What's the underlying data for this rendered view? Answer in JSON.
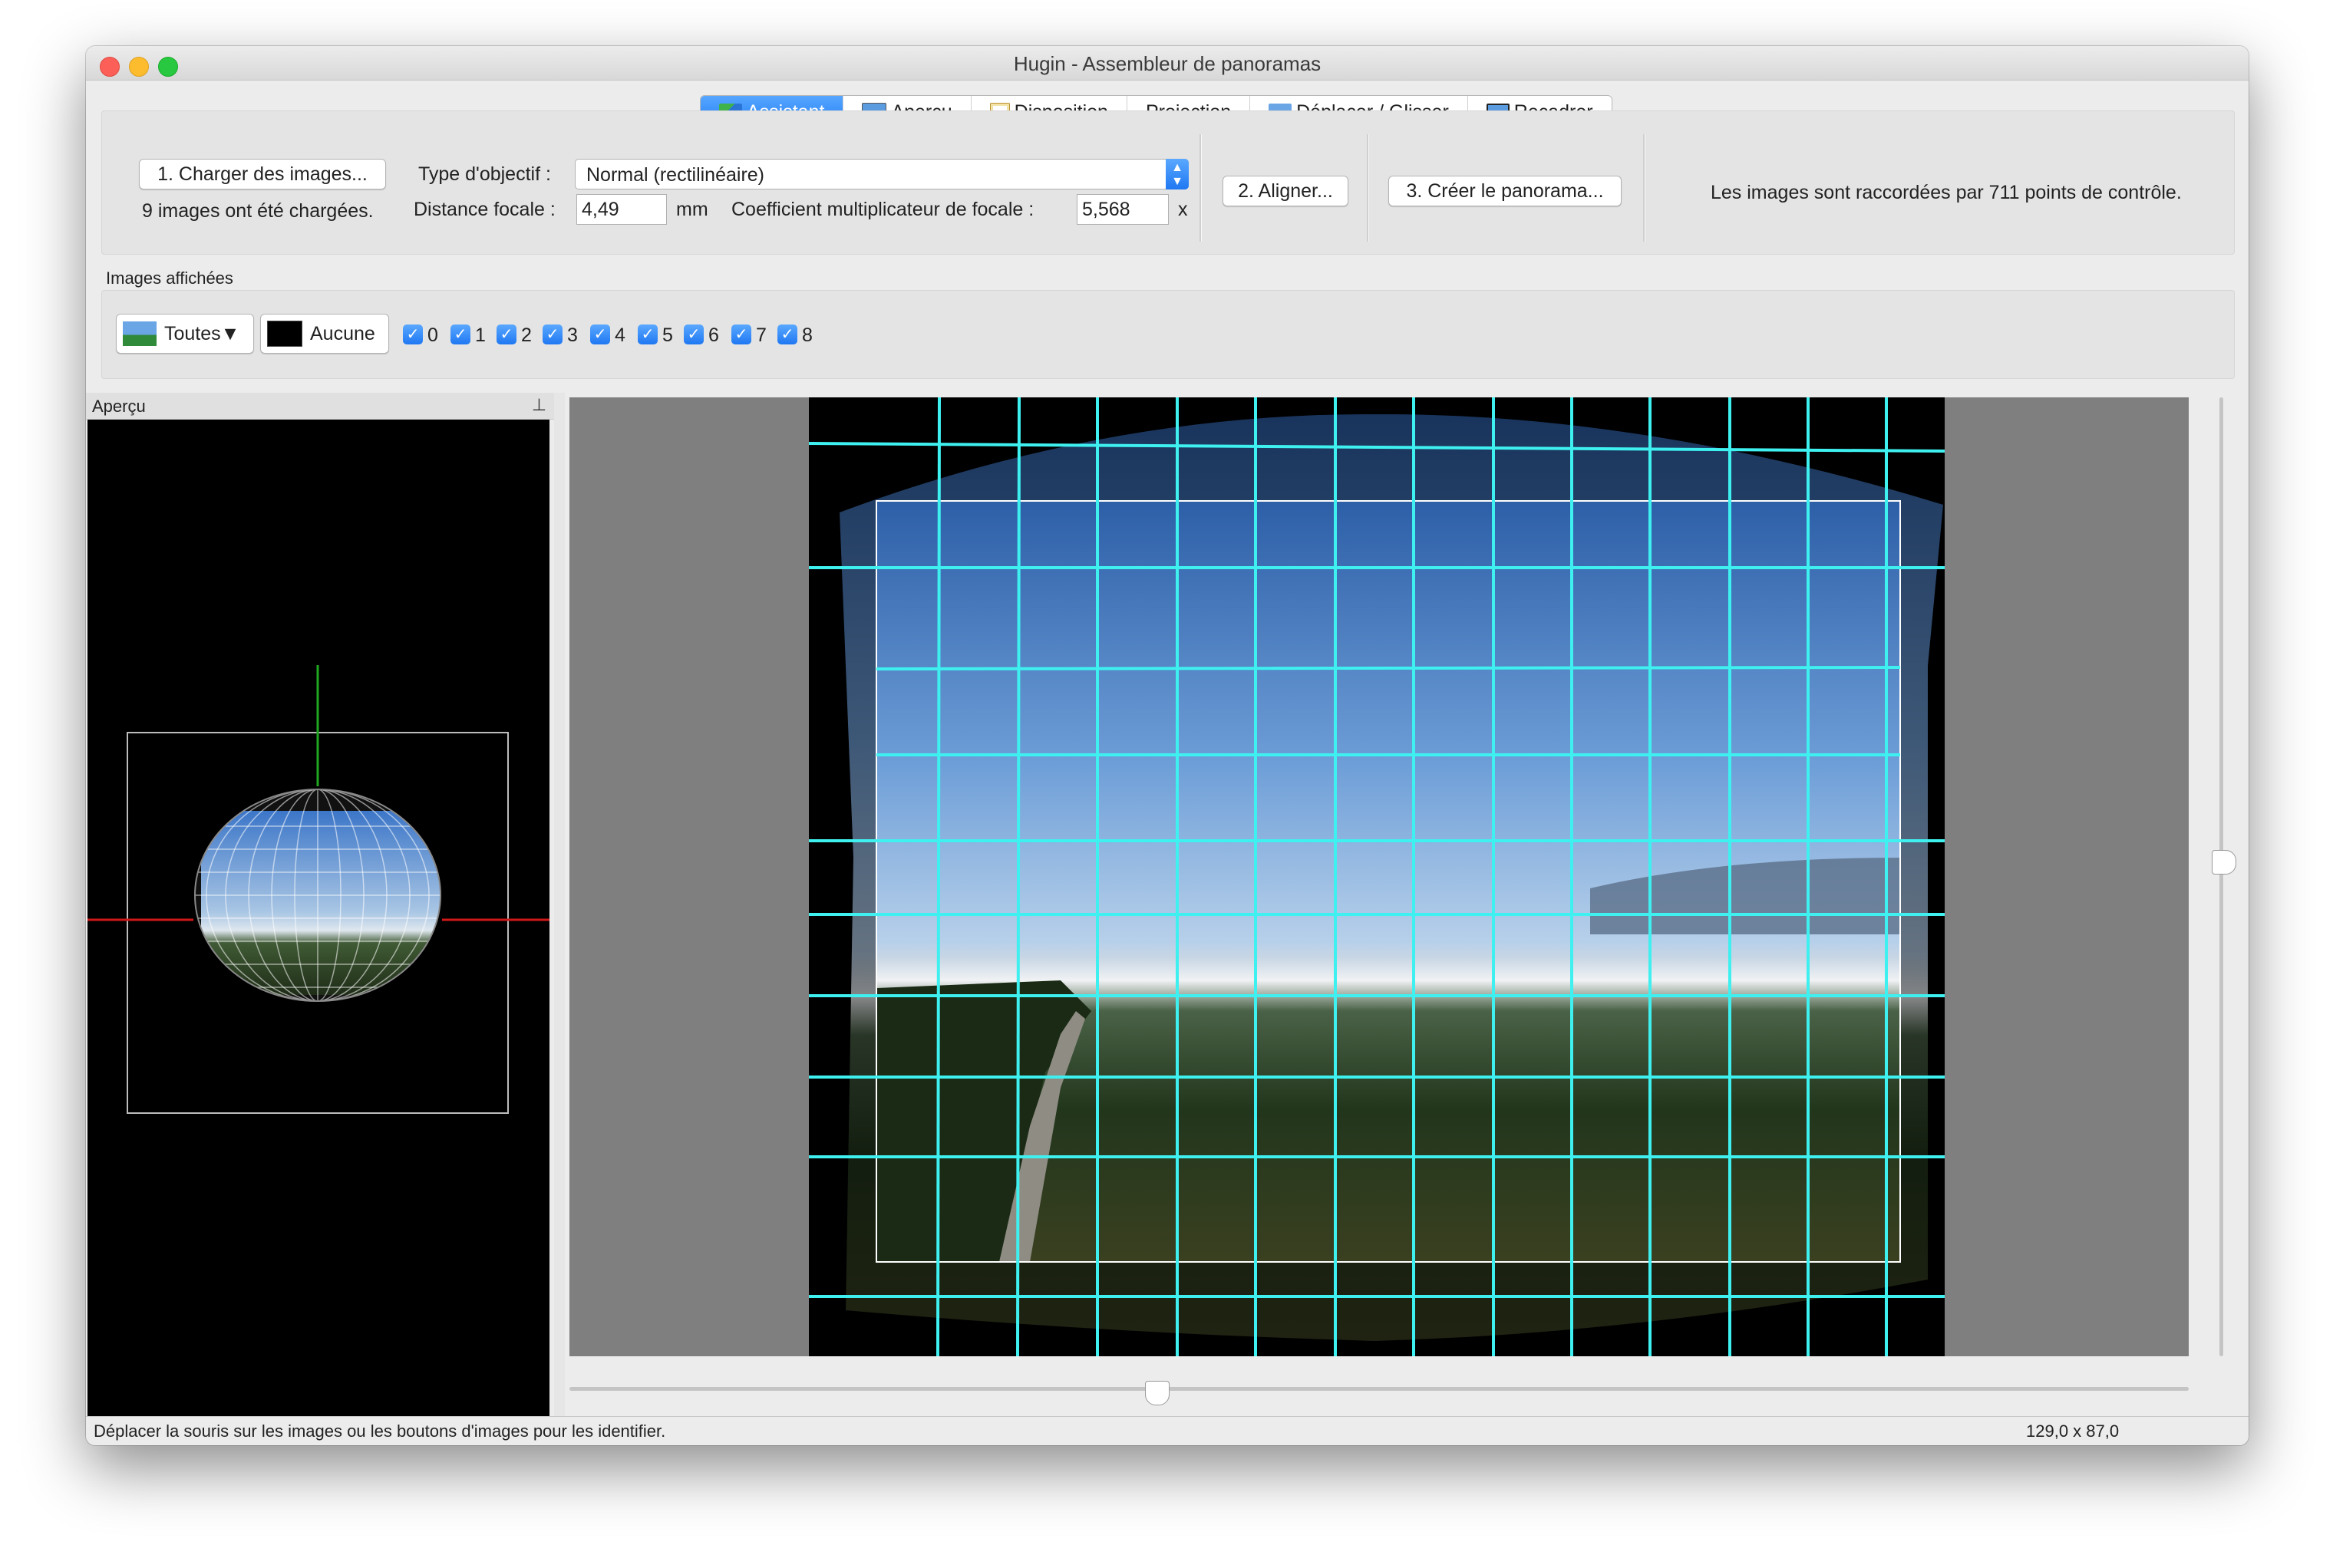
{
  "window": {
    "title": "Hugin - Assembleur de panoramas"
  },
  "tabs": [
    {
      "label": "Assistant",
      "icon": "wizard-icon",
      "active": true
    },
    {
      "label": "Aperçu",
      "icon": "preview-icon",
      "active": false
    },
    {
      "label": "Disposition",
      "icon": "layout-icon",
      "active": false
    },
    {
      "label": "Projection",
      "icon": "",
      "active": false
    },
    {
      "label": "Déplacer / Glisser",
      "icon": "move-drag-icon",
      "active": false
    },
    {
      "label": "Recadrer",
      "icon": "crop-icon",
      "active": false
    }
  ],
  "assistant": {
    "load_button": "1. Charger des images...",
    "loaded_status": "9 images ont été chargées.",
    "lens_type_label": "Type d'objectif :",
    "lens_type_value": "Normal (rectilinéaire)",
    "focal_length_label": "Distance focale :",
    "focal_length_value": "4,49",
    "focal_length_unit": "mm",
    "crop_factor_label": "Coefficient multiplicateur de focale :",
    "crop_factor_value": "5,568",
    "crop_factor_unit": "x",
    "align_button": "2. Aligner...",
    "create_button": "3. Créer le panorama...",
    "control_points_status": "Les images sont raccordées par 711 points de contrôle."
  },
  "displayed_images": {
    "section_label": "Images affichées",
    "all_button": "Toutes▼",
    "none_button": "Aucune",
    "images": [
      {
        "label": "0",
        "checked": true
      },
      {
        "label": "1",
        "checked": true
      },
      {
        "label": "2",
        "checked": true
      },
      {
        "label": "3",
        "checked": true
      },
      {
        "label": "4",
        "checked": true
      },
      {
        "label": "5",
        "checked": true
      },
      {
        "label": "6",
        "checked": true
      },
      {
        "label": "7",
        "checked": true
      },
      {
        "label": "8",
        "checked": true
      }
    ]
  },
  "overview_panel": {
    "title": "Aperçu"
  },
  "status_bar": {
    "message": "Déplacer la souris sur les images ou les boutons d'images pour les identifier.",
    "fov": "129,0 x 87,0"
  },
  "colors": {
    "accent": "#1f7bf5",
    "grid": "#3ff0f0",
    "window_bg": "#ececec"
  }
}
